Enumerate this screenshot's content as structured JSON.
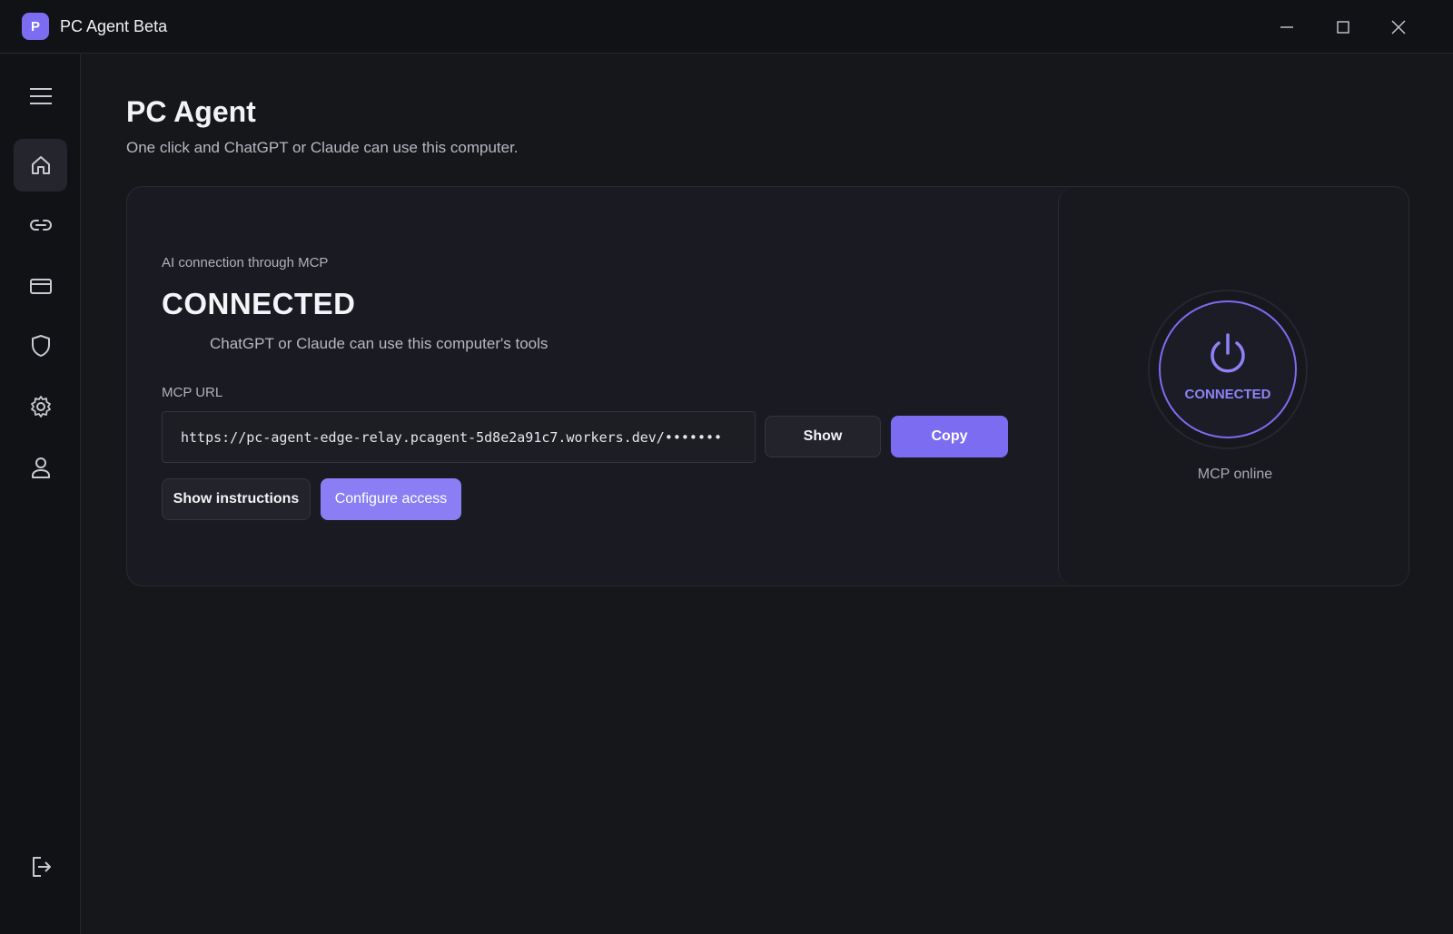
{
  "window": {
    "logo_letter": "P",
    "title": "PC Agent Beta"
  },
  "sidebar": {
    "items": [
      {
        "icon": "menu-icon"
      },
      {
        "icon": "home-icon",
        "active": true
      },
      {
        "icon": "link-icon"
      },
      {
        "icon": "card-icon"
      },
      {
        "icon": "shield-icon"
      },
      {
        "icon": "gear-icon"
      },
      {
        "icon": "user-icon"
      },
      {
        "icon": "logout-icon"
      }
    ]
  },
  "main": {
    "title": "PC Agent",
    "subtitle": "One click and ChatGPT or Claude can use this computer."
  },
  "connection": {
    "label": "AI connection through MCP",
    "status": "CONNECTED",
    "description": "ChatGPT or Claude can use this computer's tools",
    "url_label": "MCP URL",
    "url_value": "https://pc-agent-edge-relay.pcagent-5d8e2a91c7.workers.dev/•••••••",
    "show_label": "Show",
    "copy_label": "Copy",
    "instructions_label": "Show instructions",
    "configure_label": "Configure access"
  },
  "status_panel": {
    "power_label": "CONNECTED",
    "online_label": "MCP online"
  },
  "colors": {
    "accent": "#7c6cf2",
    "background": "#16171b",
    "sidebar": "#111216"
  }
}
